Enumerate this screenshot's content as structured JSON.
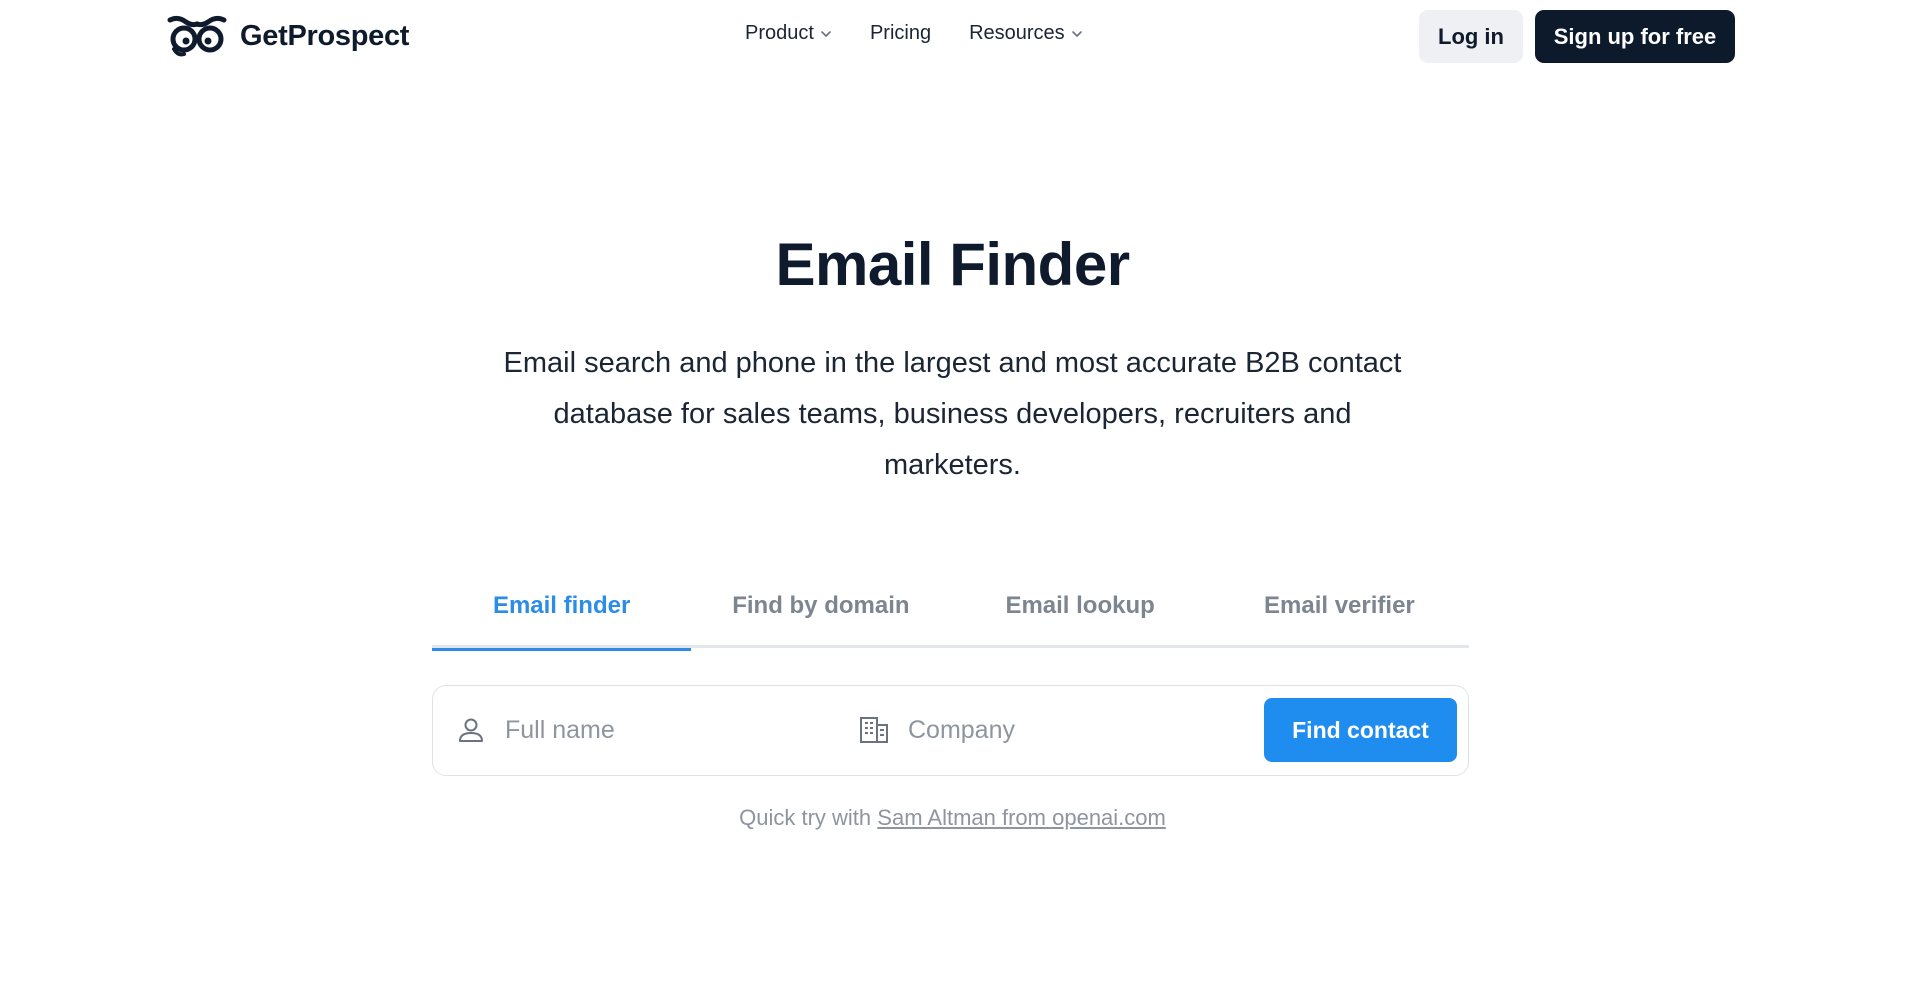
{
  "brand": {
    "name": "GetProspect",
    "logo_icon": "owl-eyes-icon"
  },
  "nav": {
    "items": [
      {
        "label": "Product",
        "has_dropdown": true
      },
      {
        "label": "Pricing",
        "has_dropdown": false
      },
      {
        "label": "Resources",
        "has_dropdown": true
      }
    ],
    "login_label": "Log in",
    "signup_label": "Sign up for free"
  },
  "hero": {
    "title": "Email Finder",
    "subtitle": "Email search and phone in the largest and most accurate B2B contact database for sales teams, business developers, recruiters and marketers."
  },
  "tabs": [
    {
      "label": "Email finder",
      "active": true
    },
    {
      "label": "Find by domain",
      "active": false
    },
    {
      "label": "Email lookup",
      "active": false
    },
    {
      "label": "Email verifier",
      "active": false
    }
  ],
  "search": {
    "name_placeholder": "Full name",
    "name_icon": "person-icon",
    "company_placeholder": "Company",
    "company_icon": "building-icon",
    "submit_label": "Find contact"
  },
  "quick_try": {
    "prefix": "Quick try with",
    "link_label": "Sam Altman from openai.com"
  },
  "colors": {
    "accent": "#1f8cf0",
    "tab_active": "#2b8de6",
    "dark": "#0d1a2b",
    "muted": "#8e959f"
  }
}
